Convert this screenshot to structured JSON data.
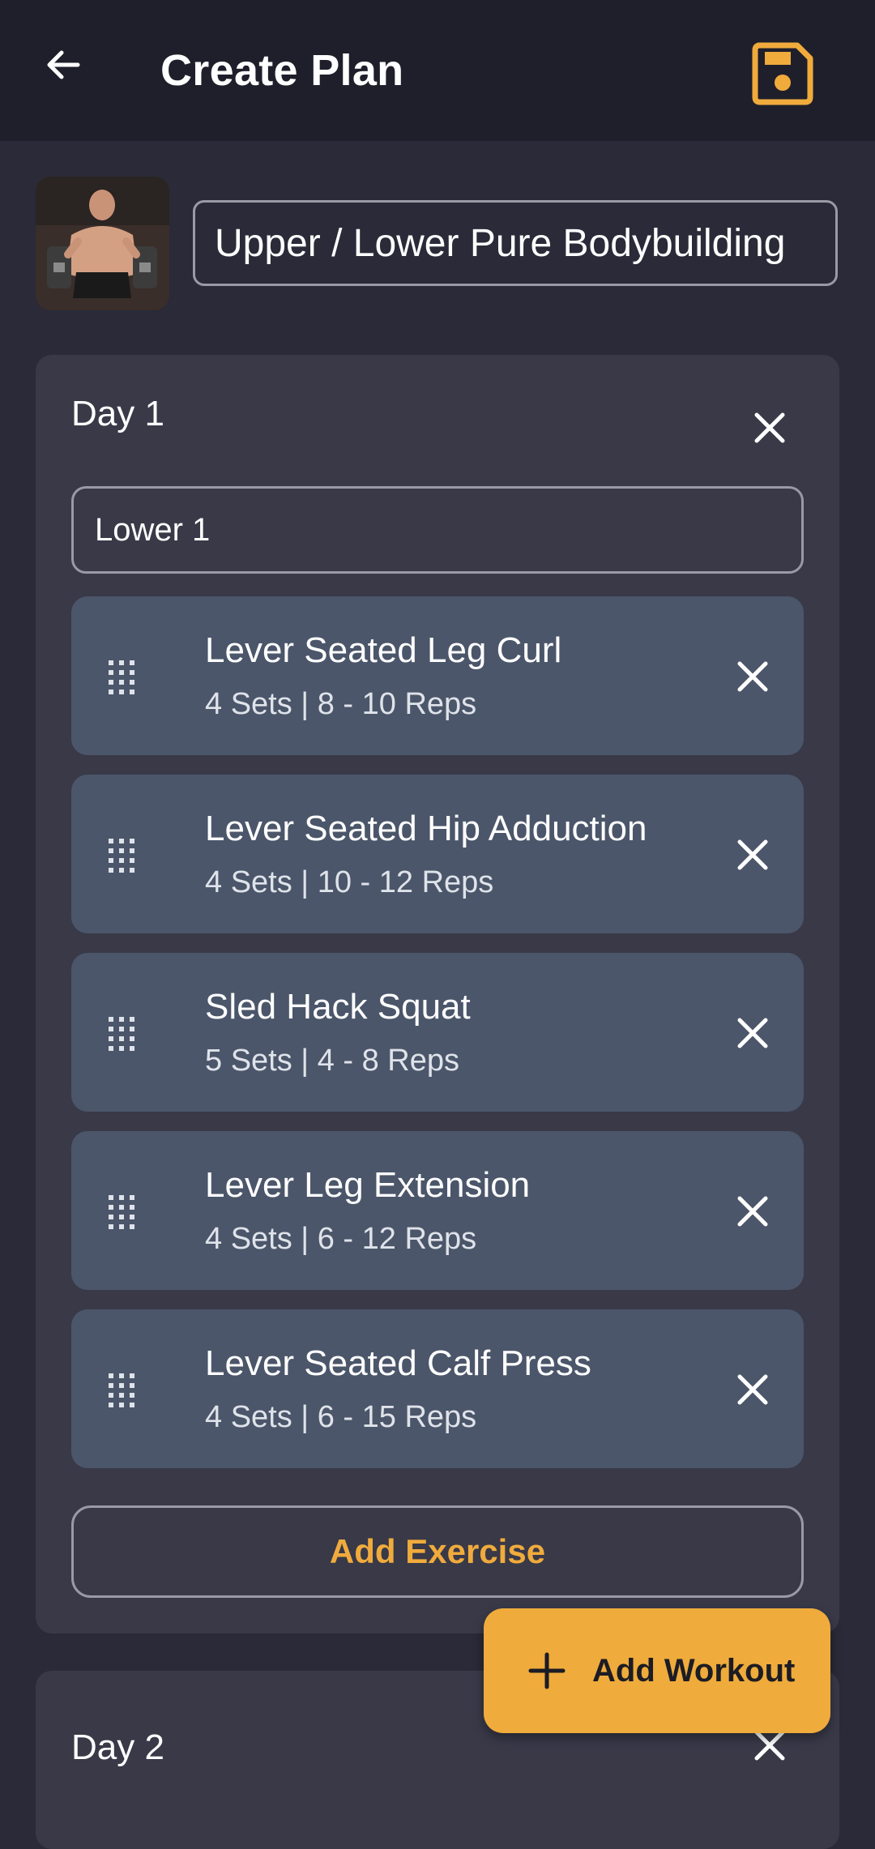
{
  "header": {
    "title": "Create Plan",
    "back_icon": "arrow-left-icon",
    "save_icon": "floppy-disk-icon",
    "accent_color": "#f0ab3c"
  },
  "plan": {
    "name": "Upper / Lower Pure Bodybuilding",
    "image": "athlete-with-dumbbells-photo"
  },
  "days": [
    {
      "label": "Day 1",
      "workout_name": "Lower 1",
      "exercises": [
        {
          "name": "Lever Seated Leg Curl",
          "detail": "4 Sets | 8 - 10 Reps"
        },
        {
          "name": "Lever Seated Hip Adduction",
          "detail": "4 Sets | 10 - 12 Reps"
        },
        {
          "name": "Sled Hack Squat",
          "detail": "5 Sets | 4 - 8 Reps"
        },
        {
          "name": "Lever Leg Extension",
          "detail": "4 Sets | 6 - 12 Reps"
        },
        {
          "name": "Lever Seated Calf Press",
          "detail": "4 Sets | 6 - 15 Reps"
        }
      ],
      "add_exercise_label": "Add Exercise"
    },
    {
      "label": "Day 2"
    }
  ],
  "fab": {
    "label": "Add Workout",
    "icon": "plus-icon"
  }
}
